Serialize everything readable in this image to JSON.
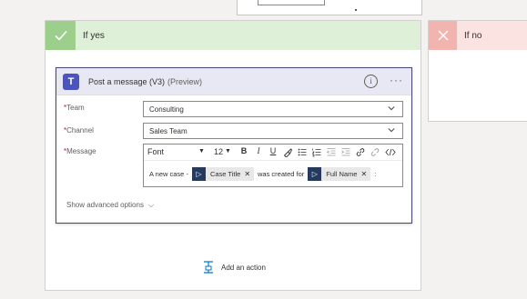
{
  "branch_yes": {
    "title": "If yes",
    "icon": "check-icon"
  },
  "branch_no": {
    "title": "If no",
    "icon": "close-icon"
  },
  "card": {
    "title": "Post a message (V3)",
    "preview": "(Preview)",
    "info_icon": "i",
    "more_icon": "···",
    "fields": {
      "team": {
        "label": "Team",
        "value": "Consulting"
      },
      "channel": {
        "label": "Channel",
        "value": "Sales Team"
      },
      "message": {
        "label": "Message"
      }
    },
    "toolbar": {
      "font": "Font",
      "font_chev": "▼",
      "size": "12",
      "size_chev": "▼",
      "bold": "B",
      "italic": "I",
      "underline": "U"
    },
    "message": {
      "prefix": "A new case -",
      "token1": "Case Title",
      "middle": "was created for",
      "token2": "Full Name",
      "suffix": ":"
    },
    "advanced": "Show advanced options"
  },
  "add_action": "Add an action",
  "colors": {
    "yes_header": "#dff0d8",
    "no_header": "#fbe3e1",
    "card_header": "#e8e8f4",
    "teams": "#4b53bc"
  }
}
